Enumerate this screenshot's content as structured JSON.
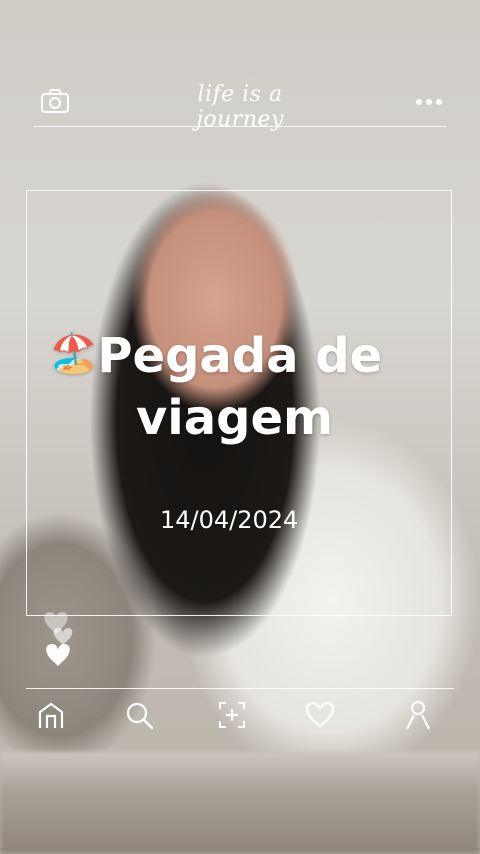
{
  "header": {
    "tagline": "life is a journey",
    "camera_icon": "camera-icon",
    "more_icon": "more-dots-icon"
  },
  "post": {
    "emoji": "🏖️",
    "title_line1": "Pegada de",
    "title_line2": "viagem",
    "date": "14/04/2024"
  },
  "nav": {
    "items": [
      "home-icon",
      "search-icon",
      "add-icon",
      "heart-icon",
      "profile-icon"
    ]
  },
  "colors": {
    "overlay": "#ffffff"
  }
}
